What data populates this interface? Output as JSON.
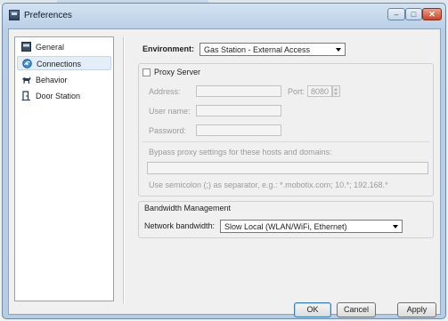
{
  "window": {
    "title": "Preferences",
    "minimize": "–",
    "maximize": "□",
    "close": "✕"
  },
  "sidebar": {
    "items": [
      {
        "label": "General",
        "icon": "window-icon"
      },
      {
        "label": "Connections",
        "icon": "connections-icon",
        "selected": true
      },
      {
        "label": "Behavior",
        "icon": "dog-icon"
      },
      {
        "label": "Door Station",
        "icon": "door-station-icon"
      }
    ]
  },
  "environment": {
    "label": "Environment:",
    "value": "Gas Station - External Access"
  },
  "proxy": {
    "title": "Proxy Server",
    "enabled": false,
    "address_label": "Address:",
    "address_value": "",
    "port_label": "Port:",
    "port_value": "8080",
    "username_label": "User name:",
    "username_value": "",
    "password_label": "Password:",
    "password_value": "",
    "bypass_label": "Bypass proxy settings for these hosts and domains:",
    "bypass_value": "",
    "hint": "Use semicolon (;) as separator, e.g.: *.mobotix.com; 10.*; 192.168.*"
  },
  "bandwidth": {
    "title": "Bandwidth Management",
    "label": "Network bandwidth:",
    "value": "Slow Local (WLAN/WiFi, Ethernet)"
  },
  "buttons": {
    "ok": "OK",
    "cancel": "Cancel",
    "apply": "Apply"
  },
  "colors": {
    "title_bar": "#b9cfe6",
    "close_button": "#c6462a",
    "selection": "#e4eef8"
  }
}
